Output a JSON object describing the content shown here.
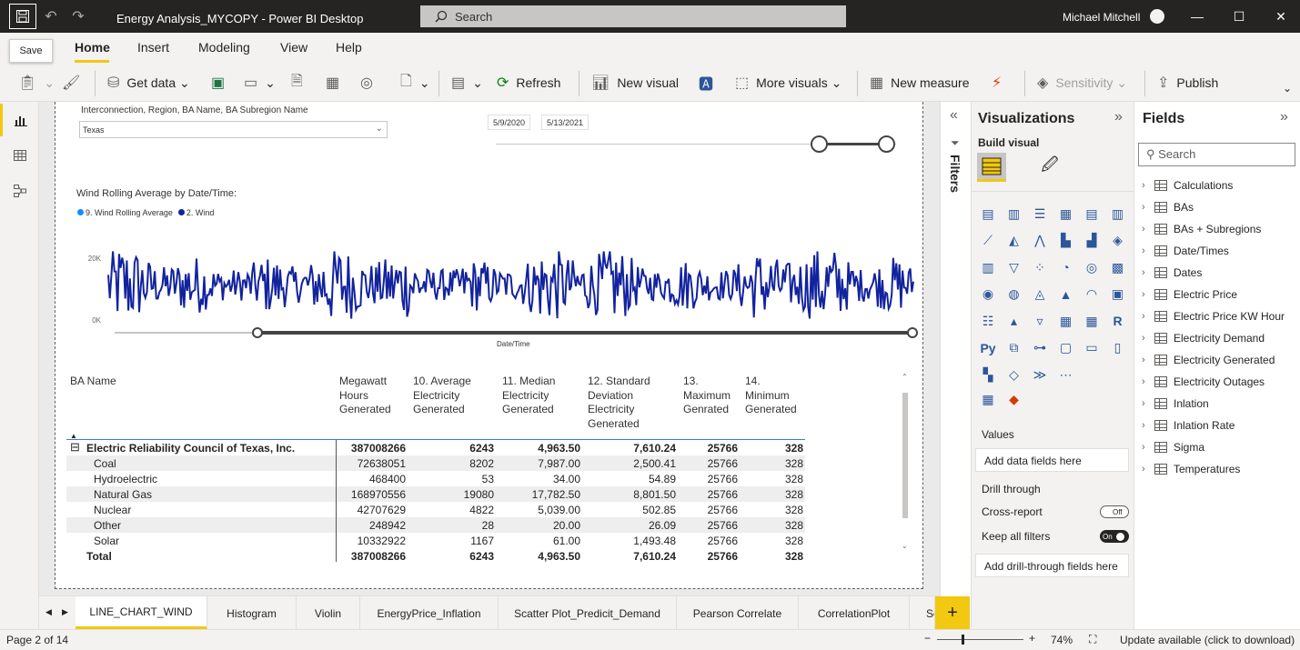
{
  "titlebar": {
    "title": "Energy Analysis_MYCOPY - Power BI Desktop",
    "search_placeholder": "Search",
    "user": "Michael Mitchell"
  },
  "tooltip": {
    "text": "Save"
  },
  "menu": {
    "tabs": [
      "Home",
      "Insert",
      "Modeling",
      "View",
      "Help"
    ],
    "active": "Home"
  },
  "ribbon": {
    "get_data": "Get data",
    "refresh": "Refresh",
    "new_visual": "New visual",
    "more_visuals": "More visuals",
    "new_measure": "New measure",
    "sensitivity": "Sensitivity",
    "publish": "Publish"
  },
  "report": {
    "slicer": {
      "label": "Interconnection, Region, BA Name, BA Subregion Name",
      "value": "Texas"
    },
    "date_slicer": {
      "start": "5/9/2020",
      "end": "5/13/2021"
    },
    "chart": {
      "title": "Wind Rolling Average by Date/Time:",
      "legend": [
        {
          "label": "9. Wind Rolling Average",
          "color": "#118dff"
        },
        {
          "label": "2. Wind",
          "color": "#12239e"
        }
      ],
      "y_ticks": [
        "20K",
        "0K"
      ],
      "x_label": "Date/Time",
      "line_color": "#12239e"
    },
    "matrix": {
      "columns": [
        "BA Name",
        "Megawatt Hours Generated",
        "10. Average Electricity Generated",
        "11. Median Electricity Generated",
        "12. Standard Deviation Electricity Generated",
        "13. Maximum Genrated",
        "14. Minimum Generated"
      ],
      "group": {
        "name": "Electric Reliability Council of Texas, Inc.",
        "values": [
          "387008266",
          "6243",
          "4,963.50",
          "7,610.24",
          "25766",
          "328"
        ]
      },
      "rows": [
        {
          "name": "Coal",
          "values": [
            "72638051",
            "8202",
            "7,987.00",
            "2,500.41",
            "25766",
            "328"
          ]
        },
        {
          "name": "Hydroelectric",
          "values": [
            "468400",
            "53",
            "34.00",
            "54.89",
            "25766",
            "328"
          ]
        },
        {
          "name": "Natural Gas",
          "values": [
            "168970556",
            "19080",
            "17,782.50",
            "8,801.50",
            "25766",
            "328"
          ]
        },
        {
          "name": "Nuclear",
          "values": [
            "42707629",
            "4822",
            "5,039.00",
            "502.85",
            "25766",
            "328"
          ]
        },
        {
          "name": "Other",
          "values": [
            "248942",
            "28",
            "20.00",
            "26.09",
            "25766",
            "328"
          ]
        },
        {
          "name": "Solar",
          "values": [
            "10332922",
            "1167",
            "61.00",
            "1,493.48",
            "25766",
            "328"
          ]
        }
      ],
      "total": {
        "name": "Total",
        "values": [
          "387008266",
          "6243",
          "4,963.50",
          "7,610.24",
          "25766",
          "328"
        ]
      }
    }
  },
  "filters_pane": {
    "label": "Filters"
  },
  "visualizations": {
    "title": "Visualizations",
    "build_visual": "Build visual",
    "values_label": "Values",
    "values_well": "Add data fields here",
    "drill_through": "Drill through",
    "cross_report": "Cross-report",
    "cross_report_state": "Off",
    "keep_all_filters": "Keep all filters",
    "keep_all_filters_state": "On",
    "drill_well": "Add drill-through fields here"
  },
  "fields": {
    "title": "Fields",
    "search_placeholder": "Search",
    "tables": [
      "Calculations",
      "BAs",
      "BAs + Subregions",
      "Date/Times",
      "Dates",
      "Electric Price",
      "Electric Price KW Hour",
      "Electricity Demand",
      "Electricity Generated",
      "Electricity Outages",
      "Inlation",
      "Inlation Rate",
      "Sigma",
      "Temperatures"
    ]
  },
  "page_tabs": {
    "tabs": [
      "LINE_CHART_WIND",
      "Histogram",
      "Violin",
      "EnergyPrice_Inflation",
      "Scatter Plot_Predicit_Demand",
      "Pearson Correlate",
      "CorrelationPlot",
      "Se"
    ],
    "active": "LINE_CHART_WIND"
  },
  "status": {
    "page": "Page 2 of 14",
    "zoom": "74%",
    "update": "Update available (click to download)"
  }
}
